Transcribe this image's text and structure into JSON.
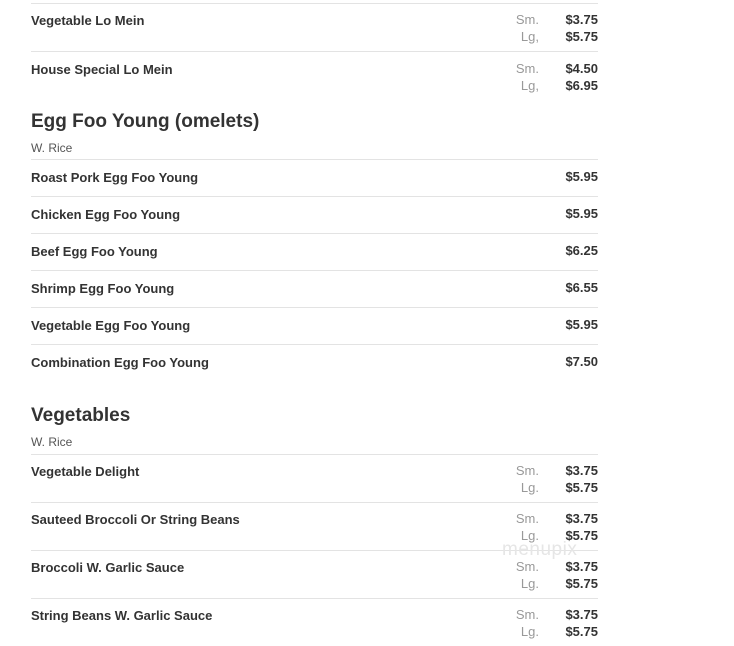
{
  "lo_mein": [
    {
      "name": "Vegetable Lo Mein",
      "prices": [
        {
          "size": "Sm.",
          "price": "$3.75"
        },
        {
          "size": "Lg,",
          "price": "$5.75"
        }
      ]
    },
    {
      "name": "House Special Lo Mein",
      "prices": [
        {
          "size": "Sm.",
          "price": "$4.50"
        },
        {
          "size": "Lg,",
          "price": "$6.95"
        }
      ]
    }
  ],
  "egg_foo_young": {
    "title": "Egg Foo Young (omelets)",
    "subtitle": "W. Rice",
    "items": [
      {
        "name": "Roast Pork Egg Foo Young",
        "price": "$5.95"
      },
      {
        "name": "Chicken Egg Foo Young",
        "price": "$5.95"
      },
      {
        "name": "Beef Egg Foo Young",
        "price": "$6.25"
      },
      {
        "name": "Shrimp Egg Foo Young",
        "price": "$6.55"
      },
      {
        "name": "Vegetable Egg Foo Young",
        "price": "$5.95"
      },
      {
        "name": "Combination Egg Foo Young",
        "price": "$7.50"
      }
    ]
  },
  "vegetables": {
    "title": "Vegetables",
    "subtitle": "W. Rice",
    "items": [
      {
        "name": "Vegetable Delight",
        "prices": [
          {
            "size": "Sm.",
            "price": "$3.75"
          },
          {
            "size": "Lg.",
            "price": "$5.75"
          }
        ]
      },
      {
        "name": "Sauteed Broccoli Or String Beans",
        "prices": [
          {
            "size": "Sm.",
            "price": "$3.75"
          },
          {
            "size": "Lg.",
            "price": "$5.75"
          }
        ]
      },
      {
        "name": "Broccoli W. Garlic Sauce",
        "prices": [
          {
            "size": "Sm.",
            "price": "$3.75"
          },
          {
            "size": "Lg.",
            "price": "$5.75"
          }
        ]
      },
      {
        "name": "String Beans W. Garlic Sauce",
        "prices": [
          {
            "size": "Sm.",
            "price": "$3.75"
          },
          {
            "size": "Lg.",
            "price": "$5.75"
          }
        ]
      }
    ]
  },
  "watermark": "menupix"
}
